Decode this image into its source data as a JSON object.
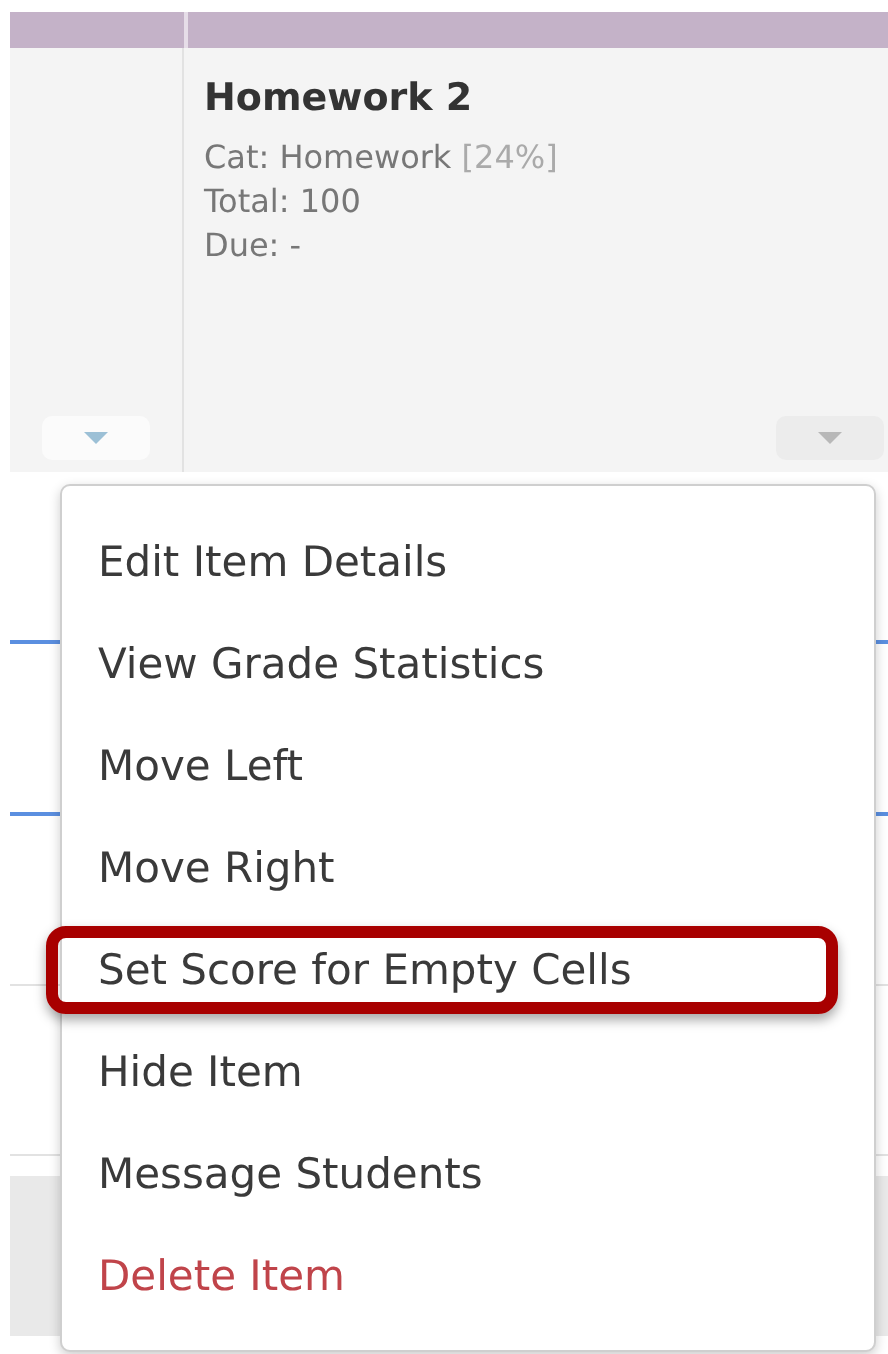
{
  "column": {
    "title": "Homework 2",
    "category": "Cat: Homework",
    "weight": "[24%]",
    "total": "Total: 100",
    "due": "Due: -"
  },
  "menu": {
    "items": [
      {
        "label": "Edit Item Details",
        "kind": "normal",
        "highlighted": false
      },
      {
        "label": "View Grade Statistics",
        "kind": "normal",
        "highlighted": false
      },
      {
        "label": "Move Left",
        "kind": "normal",
        "highlighted": false
      },
      {
        "label": "Move Right",
        "kind": "normal",
        "highlighted": false
      },
      {
        "label": "Set Score for Empty Cells",
        "kind": "normal",
        "highlighted": true
      },
      {
        "label": "Hide Item",
        "kind": "normal",
        "highlighted": false
      },
      {
        "label": "Message Students",
        "kind": "normal",
        "highlighted": false
      },
      {
        "label": "Delete Item",
        "kind": "danger",
        "highlighted": false
      }
    ]
  }
}
